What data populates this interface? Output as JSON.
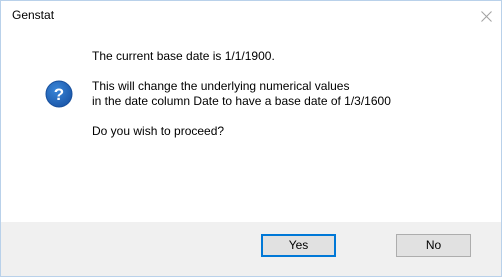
{
  "window": {
    "title": "Genstat",
    "close_icon": "close-icon"
  },
  "message": {
    "icon": "question-icon",
    "line1": "The current base date is 1/1/1900.",
    "line2": "This will change the underlying numerical values",
    "line3": "in the date column Date to have a base date of 1/3/1600",
    "line4": "Do you wish to proceed?"
  },
  "buttons": {
    "yes_label": "Yes",
    "no_label": "No"
  },
  "colors": {
    "icon_blue": "#1e63b9",
    "default_button_border": "#0078d7",
    "footer_background": "#f0f0f0"
  }
}
